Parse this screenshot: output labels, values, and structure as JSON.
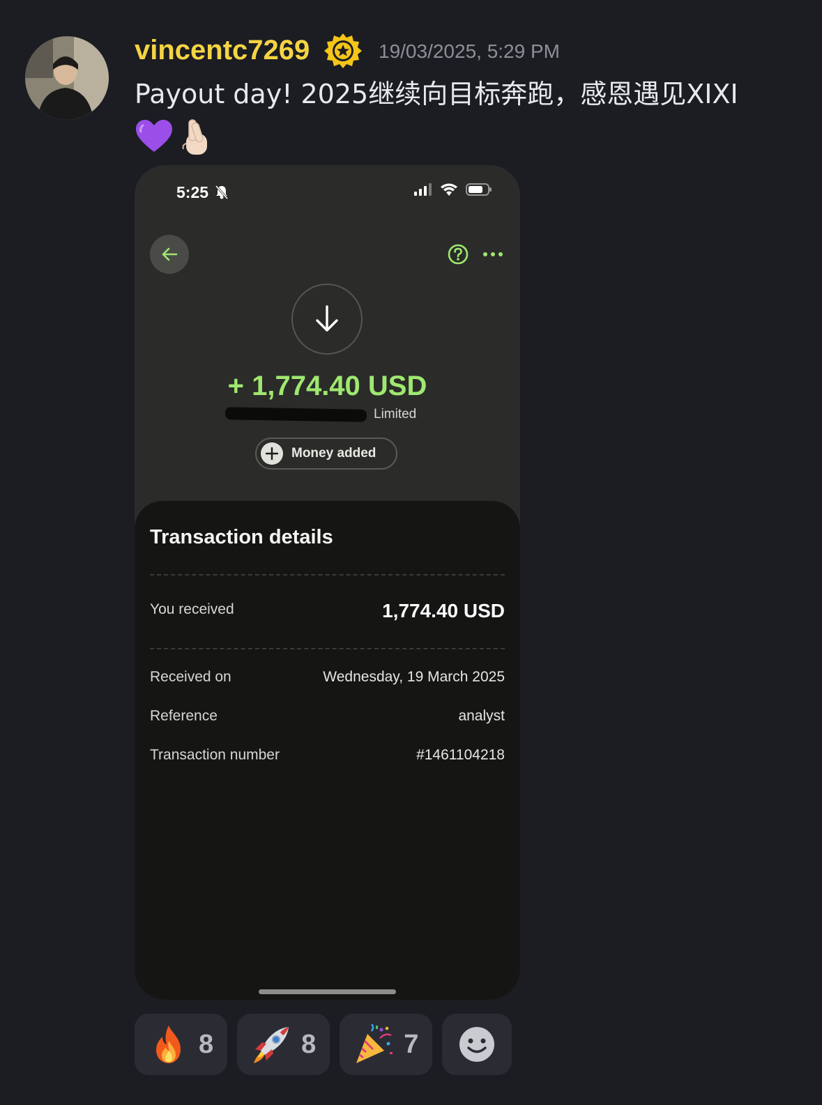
{
  "post": {
    "username": "vincentc7269",
    "timestamp": "19/03/2025, 5:29 PM",
    "message": "Payout day! 2025继续向目标奔跑，感恩遇见XIXI",
    "colors": {
      "username": "#f5d443",
      "badge": "#f5c518"
    },
    "emoji": [
      "purple-heart-icon",
      "crossed-fingers-icon"
    ]
  },
  "phone": {
    "status_time": "5:25",
    "amount": "+ 1,774.40 USD",
    "sender_suffix": "Limited",
    "status_label": "Money added",
    "accent": "#9fe870",
    "details": {
      "title": "Transaction details",
      "received_label": "You received",
      "received_value": "1,774.40 USD",
      "received_on_label": "Received on",
      "received_on_value": "Wednesday, 19 March 2025",
      "reference_label": "Reference",
      "reference_value": "analyst",
      "txn_label": "Transaction number",
      "txn_value": "#1461104218"
    }
  },
  "reactions": [
    {
      "icon": "fire-icon",
      "count": "8"
    },
    {
      "icon": "rocket-icon",
      "count": "8"
    },
    {
      "icon": "party-popper-icon",
      "count": "7"
    }
  ]
}
